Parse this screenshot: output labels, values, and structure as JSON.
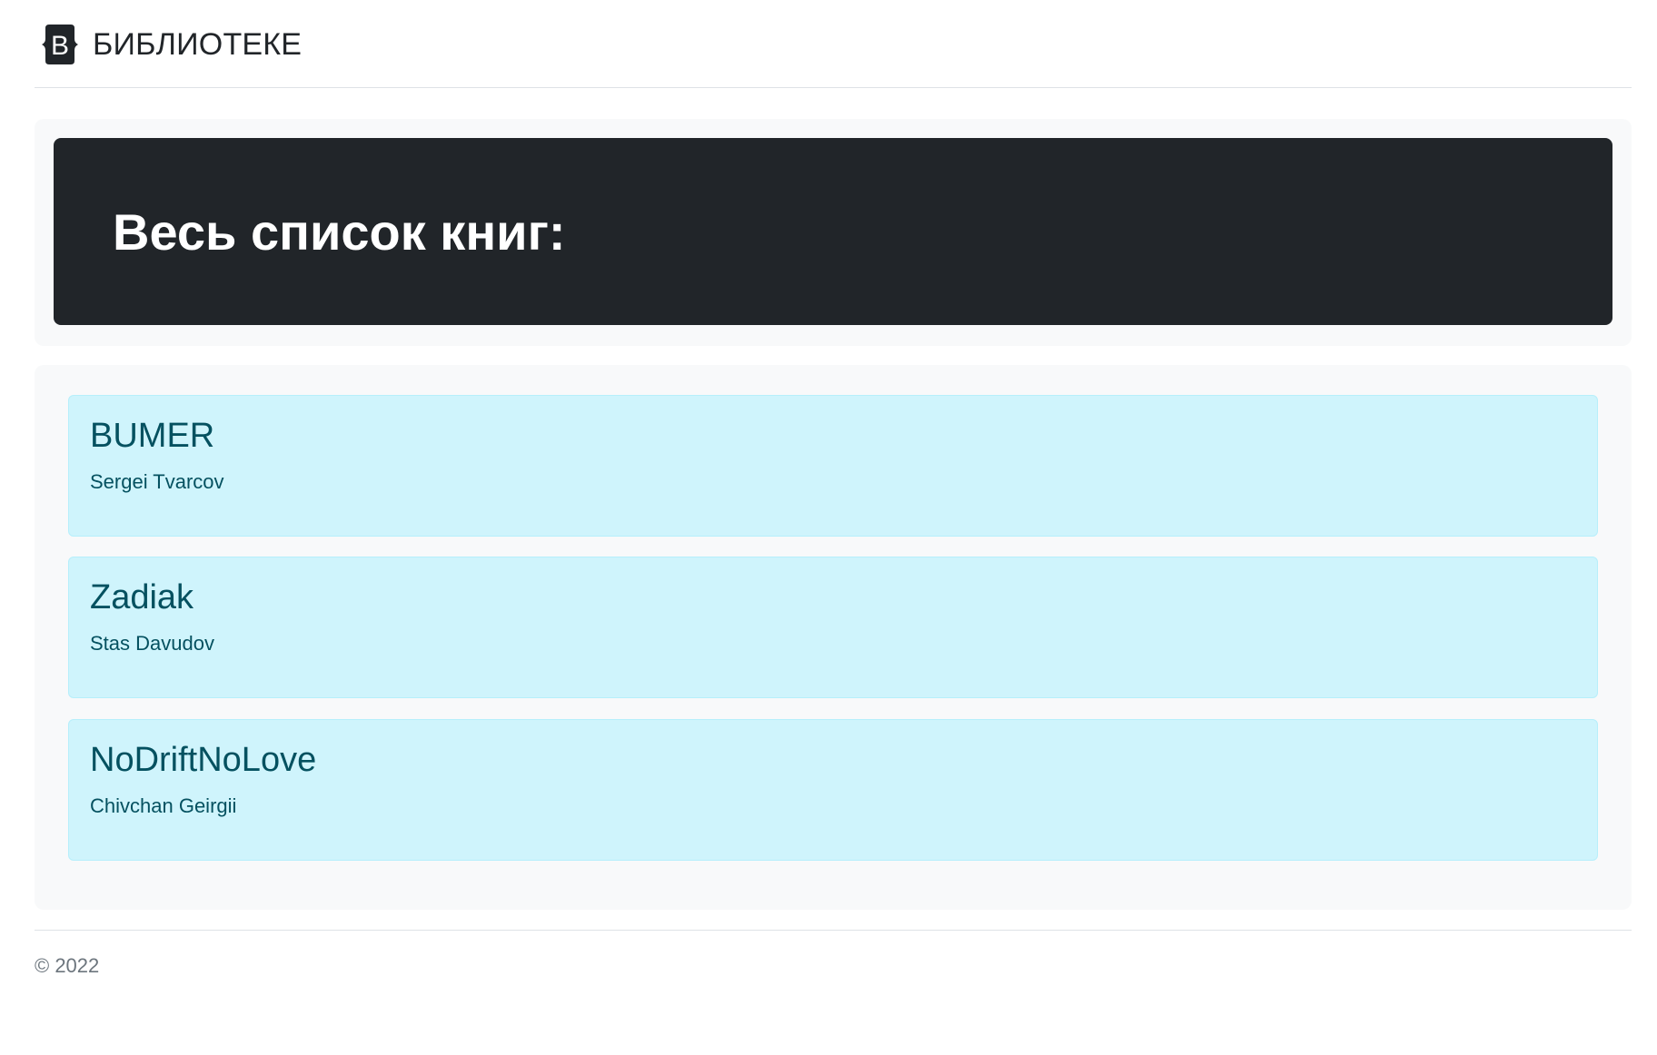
{
  "header": {
    "logo_letter": "B",
    "brand_title": "БИБЛИОТЕКЕ"
  },
  "hero": {
    "title": "Весь список книг:"
  },
  "books": [
    {
      "title": "BUMER",
      "author": "Sergei Tvarcov"
    },
    {
      "title": "Zadiak",
      "author": "Stas Davudov"
    },
    {
      "title": "NoDriftNoLove",
      "author": "Chivchan Geirgii"
    }
  ],
  "footer": {
    "copyright": "© 2022"
  },
  "colors": {
    "hero_bg": "#212529",
    "card_bg": "#cff4fc",
    "card_text": "#055160",
    "panel_bg": "#f8f9fa"
  }
}
